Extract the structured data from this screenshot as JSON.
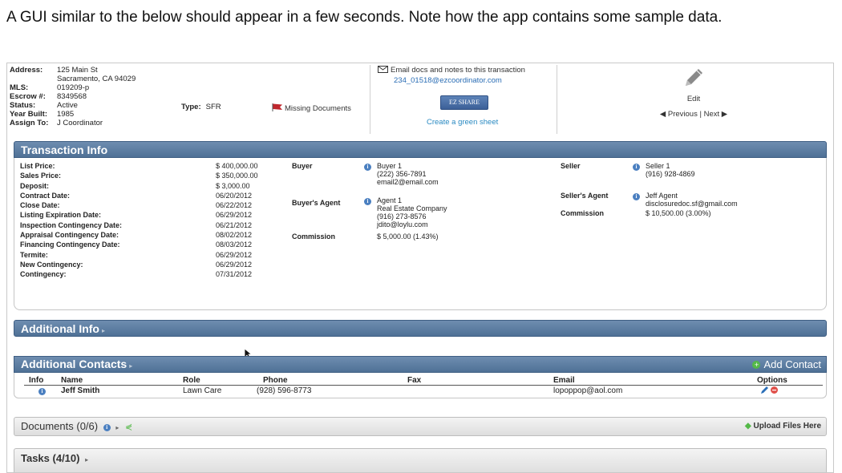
{
  "intro_text": "A GUI similar to the below should appear in a few seconds. Note how the app contains some sample data.",
  "property": {
    "address_label": "Address:",
    "address_line1": "125 Main St",
    "address_line2": "Sacramento, CA 94029",
    "mls_label": "MLS:",
    "mls": "019209-p",
    "escrow_label": "Escrow #:",
    "escrow": "8349568",
    "status_label": "Status:",
    "status": "Active",
    "year_label": "Year Built:",
    "year": "1985",
    "assign_label": "Assign To:",
    "assign": "J Coordinator",
    "type_label": "Type:",
    "type": "SFR",
    "missing_docs": "Missing Documents"
  },
  "email_panel": {
    "email_text": "Email docs and notes to this transaction",
    "email_address": "234_01518@ezcoordinator.com",
    "share_label": "EZ SHARE",
    "green_sheet": "Create a green sheet"
  },
  "edit_panel": {
    "edit_label": "Edit",
    "previous": "Previous",
    "separator": "|",
    "next": "Next"
  },
  "transaction_info": {
    "title": "Transaction Info",
    "rows": [
      {
        "label": "List Price:",
        "value": "$ 400,000.00"
      },
      {
        "label": "Sales Price:",
        "value": "$ 350,000.00"
      },
      {
        "label": "Deposit:",
        "value": "$ 3,000.00"
      },
      {
        "label": "Contract Date:",
        "value": "06/20/2012"
      },
      {
        "label": "Close Date:",
        "value": "06/22/2012"
      },
      {
        "label": "Listing Expiration Date:",
        "value": "06/29/2012"
      },
      {
        "label": "Inspection Contingency Date:",
        "value": "06/21/2012"
      },
      {
        "label": "Appraisal Contingency Date:",
        "value": "08/02/2012"
      },
      {
        "label": "Financing Contingency Date:",
        "value": "08/03/2012"
      },
      {
        "label": "Termite:",
        "value": "06/29/2012"
      },
      {
        "label": "New Contingency:",
        "value": "06/29/2012"
      },
      {
        "label": "Contingency:",
        "value": "07/31/2012"
      }
    ],
    "buyer_label": "Buyer",
    "buyer_name": "Buyer 1",
    "buyer_phone": "(222) 356-7891",
    "buyer_email": "email2@email.com",
    "buyer_agent_label": "Buyer's Agent",
    "buyer_agent_name": "Agent 1",
    "buyer_agent_company": "Real Estate Company",
    "buyer_agent_phone": "(916) 273-8576",
    "buyer_agent_email": "jdito@loylu.com",
    "buyer_commission_label": "Commission",
    "buyer_commission": "$ 5,000.00 (1.43%)",
    "seller_label": "Seller",
    "seller_name": "Seller 1",
    "seller_phone": "(916) 928-4869",
    "seller_agent_label": "Seller's Agent",
    "seller_agent_name": "Jeff Agent",
    "seller_agent_email": "disclosuredoc.sf@gmail.com",
    "seller_commission_label": "Commission",
    "seller_commission": "$ 10,500.00 (3.00%)"
  },
  "additional_info": {
    "title": "Additional Info"
  },
  "additional_contacts": {
    "title": "Additional Contacts",
    "add_label": "Add Contact",
    "headers": {
      "info": "Info",
      "name": "Name",
      "role": "Role",
      "phone": "Phone",
      "fax": "Fax",
      "email": "Email",
      "options": "Options"
    },
    "row": {
      "name": "Jeff Smith",
      "role": "Lawn Care",
      "phone": "(928) 596-8773",
      "fax": "",
      "email": "lopoppop@aol.com"
    }
  },
  "documents": {
    "title": "Documents (0/6)",
    "upload": "Upload Files Here"
  },
  "tasks": {
    "title": "Tasks (4/10)"
  },
  "colors": {
    "section_header": "#5a7a9f",
    "link": "#2a6db5",
    "flag": "#c0272d",
    "add_green": "#54b948"
  }
}
